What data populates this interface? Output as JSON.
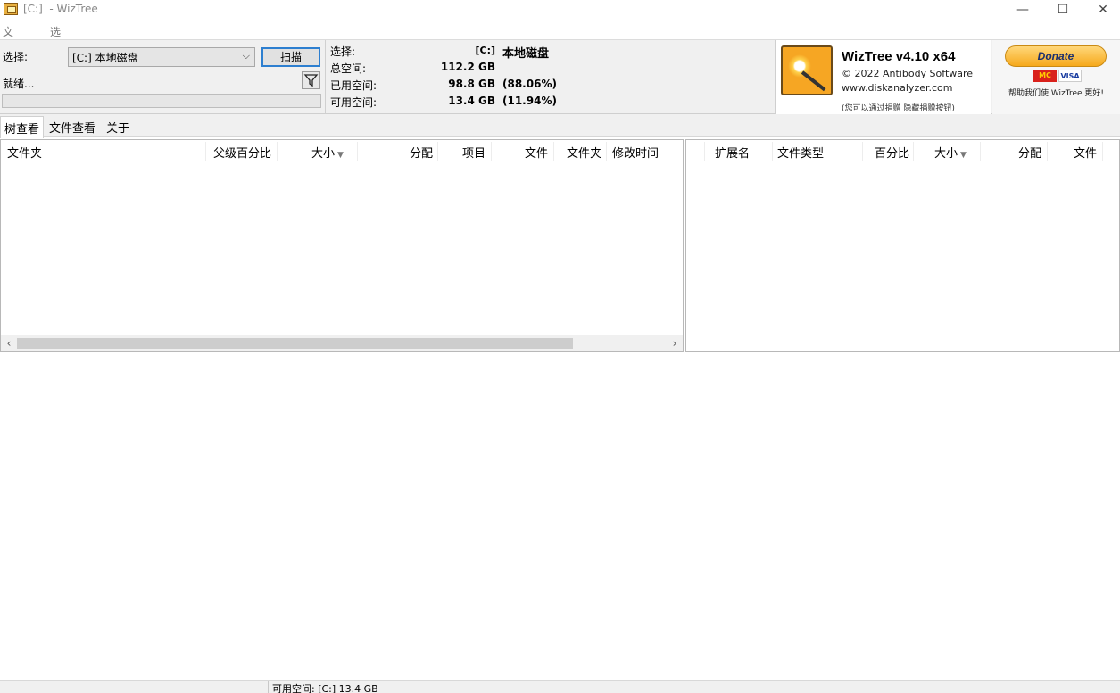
{
  "window": {
    "title": "[C:]  - WizTree",
    "minimize": "—",
    "maximize": "☐",
    "close": "✕"
  },
  "menu": [
    "文件(Z)",
    "选项(Y)"
  ],
  "toolbar": {
    "select_label": "选择:",
    "drive_value": "[C:] 本地磁盘",
    "scan_label": "扫描",
    "status": "就绪...",
    "progress": 0
  },
  "disk_info": {
    "select_label": "选择:",
    "select_drive": "[C:]",
    "select_name": "本地磁盘",
    "total_label": "总空间:",
    "total_value": "112.2 GB",
    "used_label": "已用空间:",
    "used_value": "98.8 GB",
    "used_pct": "(88.06%)",
    "free_label": "可用空间:",
    "free_value": "13.4 GB",
    "free_pct": "(11.94%)"
  },
  "brand": {
    "title": "WizTree v4.10 x64",
    "copyright": "© 2022 Antibody Software",
    "website": "www.diskanalyzer.com",
    "note": "(您可以通过捐赠 隐藏捐赠按钮)"
  },
  "donate": {
    "button": "Donate",
    "card_mc": "MasterCard",
    "card_visa": "VISA",
    "help": "帮助我们使 WizTree 更好!"
  },
  "tabs": [
    "树查看",
    "文件查看",
    "关于"
  ],
  "tree_columns": [
    "文件夹",
    "父级百分比",
    "大小",
    "分配",
    "项目",
    "文件",
    "文件夹",
    "修改时间"
  ],
  "ext_columns": [
    "扩展名",
    "文件类型",
    "百分比",
    "大小",
    "分配",
    "文件"
  ],
  "statusbar": {
    "text": "可用空间: [C:] 13.4 GB"
  }
}
